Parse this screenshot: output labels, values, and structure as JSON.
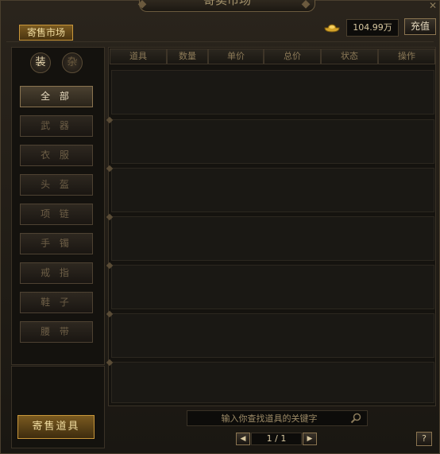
{
  "window": {
    "title": "寄卖市场"
  },
  "tabs": {
    "market": "寄售市场"
  },
  "currency": {
    "icon": "gold-ingot-icon",
    "balance": "104.99万"
  },
  "buttons": {
    "recharge": "充值",
    "sell_item": "寄售道具",
    "help": "?"
  },
  "category_toggles": [
    {
      "label": "装",
      "active": true
    },
    {
      "label": "杂",
      "active": false
    }
  ],
  "categories": [
    {
      "label": "全 部",
      "active": true
    },
    {
      "label": "武 器",
      "active": false
    },
    {
      "label": "衣 服",
      "active": false
    },
    {
      "label": "头 盔",
      "active": false
    },
    {
      "label": "项 链",
      "active": false
    },
    {
      "label": "手 镯",
      "active": false
    },
    {
      "label": "戒 指",
      "active": false
    },
    {
      "label": "鞋 子",
      "active": false
    },
    {
      "label": "腰 带",
      "active": false
    }
  ],
  "table": {
    "columns": [
      "道具",
      "数量",
      "单价",
      "总价",
      "状态",
      "操作"
    ],
    "rows": []
  },
  "search": {
    "placeholder": "输入你查找道具的关键字",
    "value": ""
  },
  "pagination": {
    "current": 1,
    "total": 1,
    "label": "1 / 1"
  },
  "colors": {
    "accent": "#c8963a",
    "panel": "#15130f",
    "text": "#b8a27a"
  }
}
